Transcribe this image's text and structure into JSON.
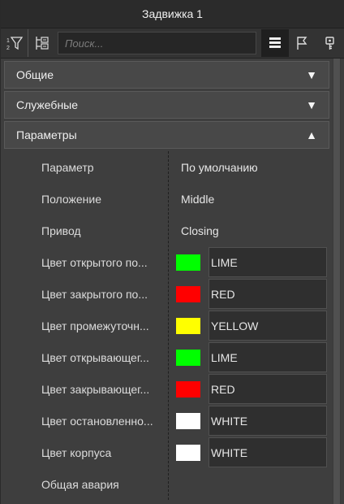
{
  "window": {
    "title": "Задвижка 1"
  },
  "toolbar": {
    "search_placeholder": "Поиск...",
    "icons": [
      "sort-filter-icon",
      "collapse-tree-icon",
      "list-view-icon",
      "flag-icon",
      "key-icon"
    ]
  },
  "sections": [
    {
      "label": "Общие",
      "expanded": false
    },
    {
      "label": "Служебные",
      "expanded": false
    },
    {
      "label": "Параметры",
      "expanded": true
    }
  ],
  "params": {
    "rows": [
      {
        "name": "Параметр",
        "value": "По умолчанию"
      },
      {
        "name": "Положение",
        "value": "Middle"
      },
      {
        "name": "Привод",
        "value": "Closing"
      },
      {
        "name": "Цвет открытого по...",
        "value": "LIME",
        "color": "#00ff00"
      },
      {
        "name": "Цвет закрытого по...",
        "value": "RED",
        "color": "#ff0000"
      },
      {
        "name": "Цвет промежуточн...",
        "value": "YELLOW",
        "color": "#ffff00"
      },
      {
        "name": "Цвет открывающег...",
        "value": "LIME",
        "color": "#00ff00"
      },
      {
        "name": "Цвет закрывающег...",
        "value": "RED",
        "color": "#ff0000"
      },
      {
        "name": "Цвет остановленно...",
        "value": "WHITE",
        "color": "#ffffff"
      },
      {
        "name": "Цвет корпуса",
        "value": "WHITE",
        "color": "#ffffff"
      },
      {
        "name": "Общая авария",
        "value": ""
      }
    ]
  }
}
